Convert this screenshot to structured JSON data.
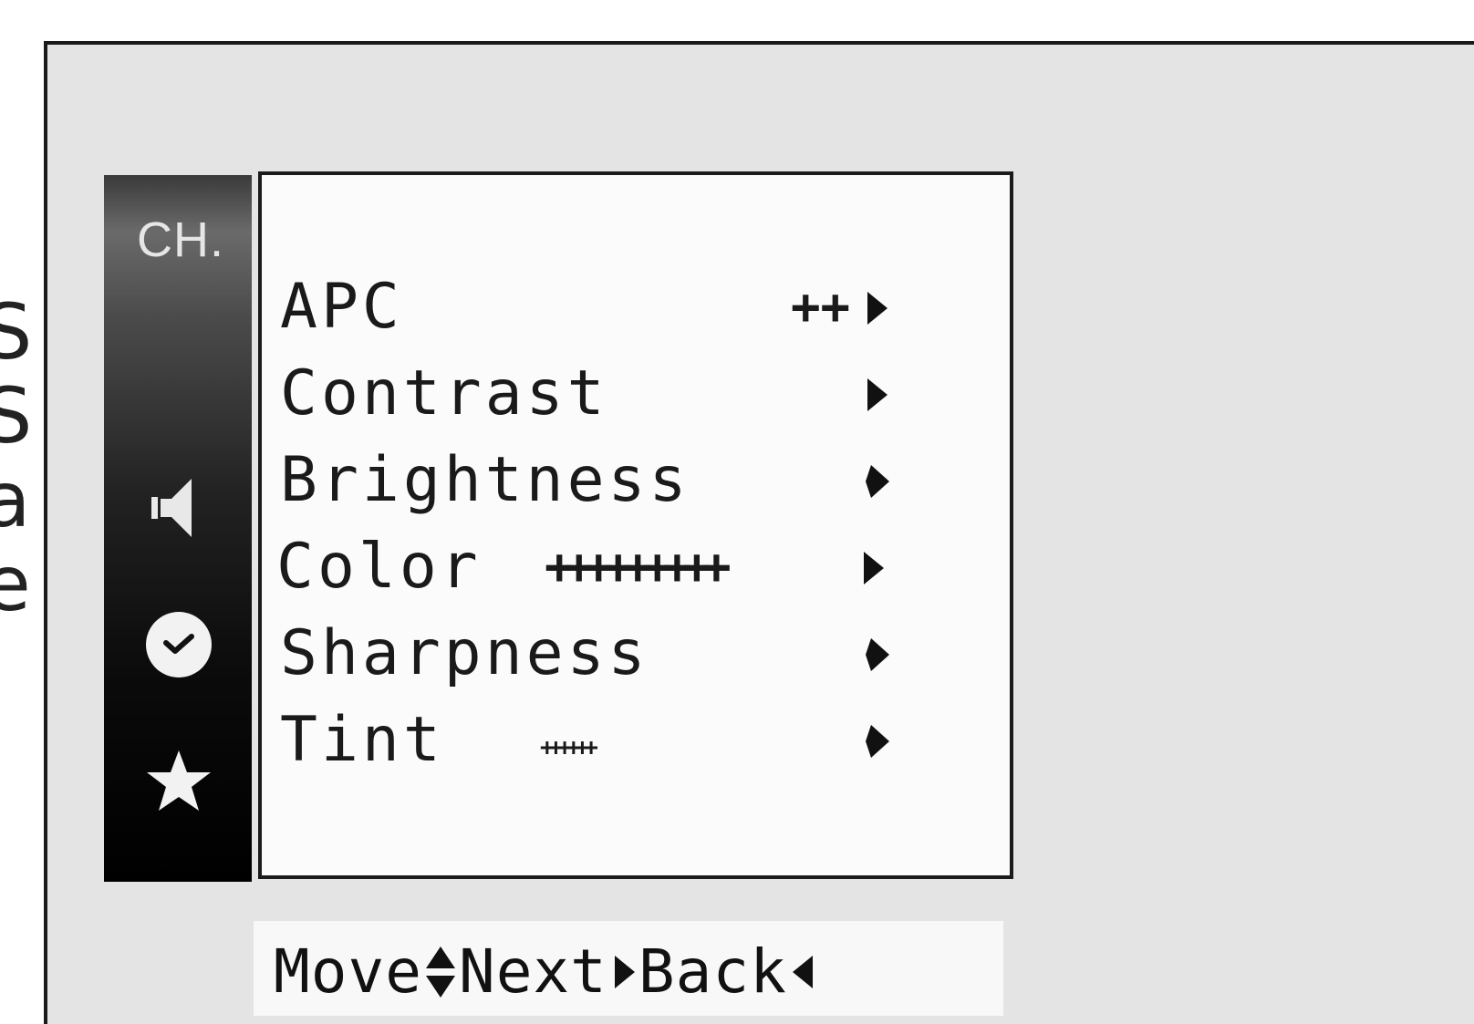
{
  "edge_fragments": [
    "S",
    "S",
    "a",
    "e"
  ],
  "sidebar": {
    "channel_label": "CH.",
    "icons": [
      "speaker-icon",
      "clock-icon",
      "star-icon"
    ]
  },
  "menu": {
    "items": [
      {
        "label": "APC",
        "value": "++",
        "arrow": "right-arrow-icon"
      },
      {
        "label": "Contrast",
        "value": "",
        "arrow": "right-arrow-icon"
      },
      {
        "label": "Brightness",
        "value": "",
        "arrow": "right-arrow-icon"
      },
      {
        "label": "Color",
        "value": "+++++++++",
        "arrow": "right-arrow-icon"
      },
      {
        "label": "Sharpness",
        "value": "",
        "arrow": "right-arrow-icon"
      },
      {
        "label": "Tint",
        "value": "++++++",
        "arrow": "right-arrow-icon"
      }
    ]
  },
  "hint": {
    "move_label": "Move",
    "next_label": "Next",
    "back_label": "Back"
  },
  "colors": {
    "frame": "#1a1a1a",
    "screen_bg": "#e4e4e4",
    "panel_bg": "#fbfbfb",
    "sidebar_dark": "#000000",
    "text": "#1a1a1a"
  }
}
